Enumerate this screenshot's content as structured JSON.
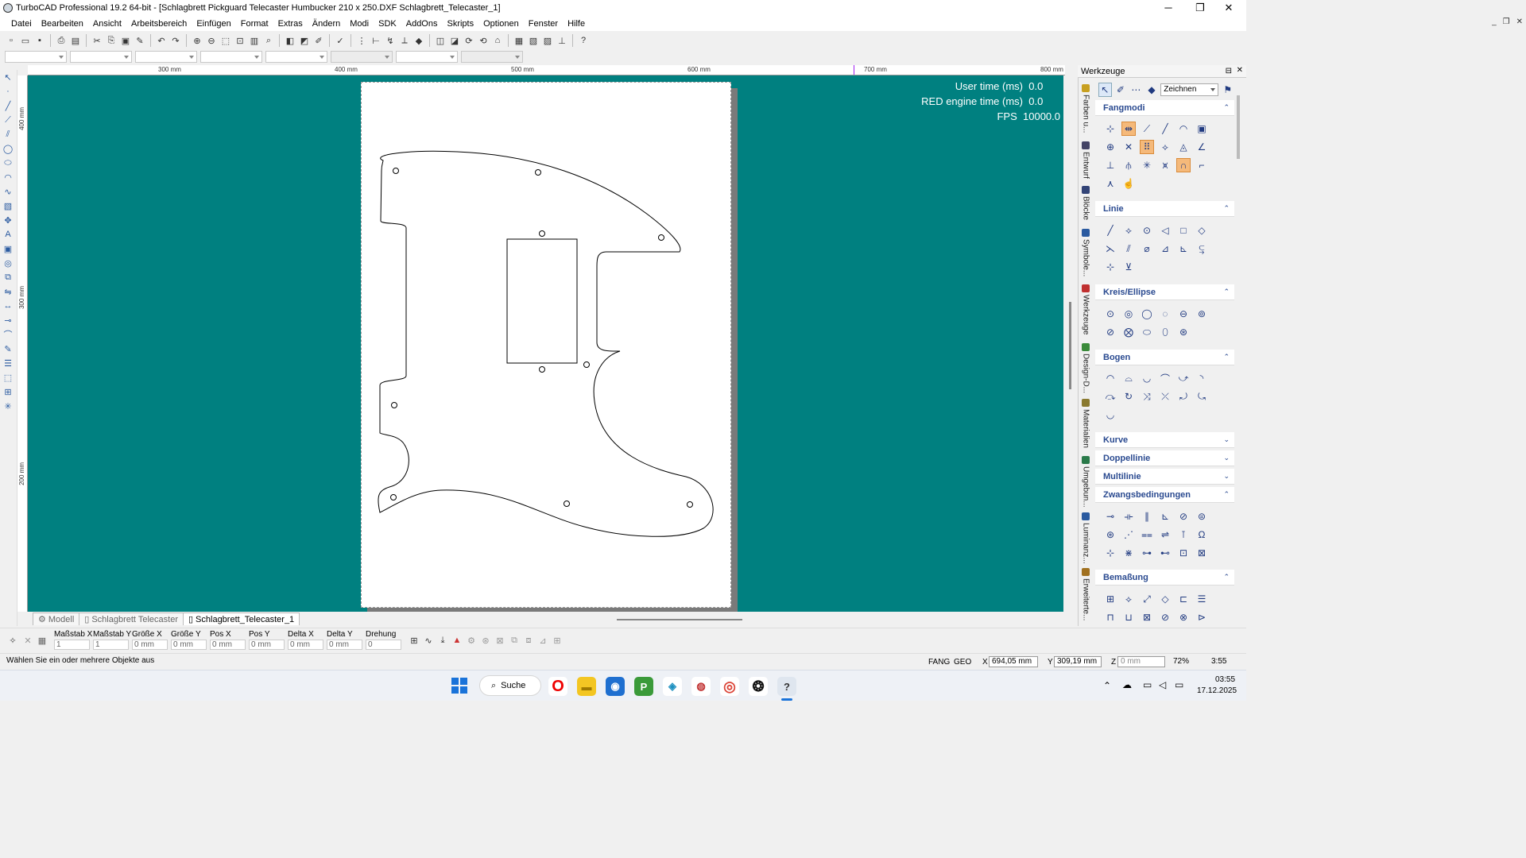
{
  "window": {
    "title": "TurboCAD Professional 19.2 64-bit - [Schlagbrett Pickguard Telecaster Humbucker  210 x 250.DXF Schlagbrett_Telecaster_1]",
    "minimize": "─",
    "maximize": "❐",
    "close": "✕"
  },
  "menu": [
    "Datei",
    "Bearbeiten",
    "Ansicht",
    "Arbeitsbereich",
    "Einfügen",
    "Format",
    "Extras",
    "Ändern",
    "Modi",
    "SDK",
    "AddOns",
    "Skripts",
    "Optionen",
    "Fenster",
    "Hilfe"
  ],
  "mdi_controls": [
    "_",
    "❐",
    "✕"
  ],
  "ruler": {
    "h_labels": [
      "300 mm",
      "400 mm",
      "500 mm",
      "600 mm",
      "700 mm",
      "800 mm"
    ],
    "v_labels": [
      "400 mm",
      "300 mm",
      "200 mm"
    ]
  },
  "canvas": {
    "user_time_label": "User time (ms)",
    "user_time": "0.0",
    "red_time_label": "RED engine time (ms)",
    "red_time": "0.0",
    "fps_label": "FPS",
    "fps": "10000.0"
  },
  "tabs": [
    {
      "label": "Modell",
      "active": false
    },
    {
      "label": "Schlagbrett Telecaster",
      "active": false
    },
    {
      "label": "Schlagbrett_Telecaster_1",
      "active": true
    }
  ],
  "panel": {
    "title": "Werkzeuge",
    "mode_select": "Zeichnen",
    "vertical_tabs": [
      "Farben u...",
      "Entwurf",
      "Blöcke",
      "Symbole...",
      "Werkzeuge",
      "Design-D...",
      "Materialien",
      "Umgebun...",
      "Luminanz...",
      "Erweiterte..."
    ],
    "sections": [
      {
        "label": "Fangmodi",
        "expanded": true
      },
      {
        "label": "Linie",
        "expanded": true
      },
      {
        "label": "Kreis/Ellipse",
        "expanded": true
      },
      {
        "label": "Bogen",
        "expanded": true
      },
      {
        "label": "Kurve",
        "expanded": false
      },
      {
        "label": "Doppellinie",
        "expanded": false
      },
      {
        "label": "Multilinie",
        "expanded": false
      },
      {
        "label": "Zwangsbedingungen",
        "expanded": true
      },
      {
        "label": "Bemaßung",
        "expanded": true
      }
    ]
  },
  "inspector": {
    "fields": [
      {
        "label": "Maßstab X",
        "value": "1"
      },
      {
        "label": "Maßstab Y",
        "value": "1"
      },
      {
        "label": "Größe X",
        "value": "0 mm"
      },
      {
        "label": "Größe Y",
        "value": "0 mm"
      },
      {
        "label": "Pos X",
        "value": "0 mm"
      },
      {
        "label": "Pos Y",
        "value": "0 mm"
      },
      {
        "label": "Delta X",
        "value": "0 mm"
      },
      {
        "label": "Delta Y",
        "value": "0 mm"
      },
      {
        "label": "Drehung",
        "value": "0"
      }
    ]
  },
  "status": {
    "message": "Wählen Sie ein oder mehrere Objekte aus",
    "fang": "FANG",
    "geo": "GEO",
    "x_label": "X",
    "x": "694,05 mm",
    "y_label": "Y",
    "y": "309,19 mm",
    "z_label": "Z",
    "z": "0 mm",
    "zoom": "72%",
    "time": "3:55"
  },
  "taskbar": {
    "search": "Suche",
    "clock_time": "03:55",
    "clock_date": "17.12.2025"
  }
}
